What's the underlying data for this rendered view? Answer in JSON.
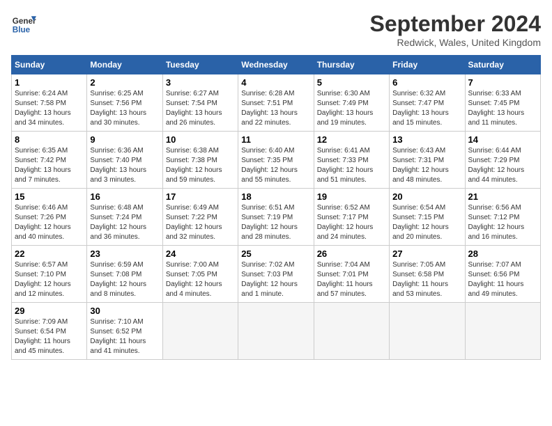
{
  "header": {
    "logo_line1": "General",
    "logo_line2": "Blue",
    "month": "September 2024",
    "location": "Redwick, Wales, United Kingdom"
  },
  "weekdays": [
    "Sunday",
    "Monday",
    "Tuesday",
    "Wednesday",
    "Thursday",
    "Friday",
    "Saturday"
  ],
  "weeks": [
    [
      {
        "day": "1",
        "info": "Sunrise: 6:24 AM\nSunset: 7:58 PM\nDaylight: 13 hours\nand 34 minutes."
      },
      {
        "day": "2",
        "info": "Sunrise: 6:25 AM\nSunset: 7:56 PM\nDaylight: 13 hours\nand 30 minutes."
      },
      {
        "day": "3",
        "info": "Sunrise: 6:27 AM\nSunset: 7:54 PM\nDaylight: 13 hours\nand 26 minutes."
      },
      {
        "day": "4",
        "info": "Sunrise: 6:28 AM\nSunset: 7:51 PM\nDaylight: 13 hours\nand 22 minutes."
      },
      {
        "day": "5",
        "info": "Sunrise: 6:30 AM\nSunset: 7:49 PM\nDaylight: 13 hours\nand 19 minutes."
      },
      {
        "day": "6",
        "info": "Sunrise: 6:32 AM\nSunset: 7:47 PM\nDaylight: 13 hours\nand 15 minutes."
      },
      {
        "day": "7",
        "info": "Sunrise: 6:33 AM\nSunset: 7:45 PM\nDaylight: 13 hours\nand 11 minutes."
      }
    ],
    [
      {
        "day": "8",
        "info": "Sunrise: 6:35 AM\nSunset: 7:42 PM\nDaylight: 13 hours\nand 7 minutes."
      },
      {
        "day": "9",
        "info": "Sunrise: 6:36 AM\nSunset: 7:40 PM\nDaylight: 13 hours\nand 3 minutes."
      },
      {
        "day": "10",
        "info": "Sunrise: 6:38 AM\nSunset: 7:38 PM\nDaylight: 12 hours\nand 59 minutes."
      },
      {
        "day": "11",
        "info": "Sunrise: 6:40 AM\nSunset: 7:35 PM\nDaylight: 12 hours\nand 55 minutes."
      },
      {
        "day": "12",
        "info": "Sunrise: 6:41 AM\nSunset: 7:33 PM\nDaylight: 12 hours\nand 51 minutes."
      },
      {
        "day": "13",
        "info": "Sunrise: 6:43 AM\nSunset: 7:31 PM\nDaylight: 12 hours\nand 48 minutes."
      },
      {
        "day": "14",
        "info": "Sunrise: 6:44 AM\nSunset: 7:29 PM\nDaylight: 12 hours\nand 44 minutes."
      }
    ],
    [
      {
        "day": "15",
        "info": "Sunrise: 6:46 AM\nSunset: 7:26 PM\nDaylight: 12 hours\nand 40 minutes."
      },
      {
        "day": "16",
        "info": "Sunrise: 6:48 AM\nSunset: 7:24 PM\nDaylight: 12 hours\nand 36 minutes."
      },
      {
        "day": "17",
        "info": "Sunrise: 6:49 AM\nSunset: 7:22 PM\nDaylight: 12 hours\nand 32 minutes."
      },
      {
        "day": "18",
        "info": "Sunrise: 6:51 AM\nSunset: 7:19 PM\nDaylight: 12 hours\nand 28 minutes."
      },
      {
        "day": "19",
        "info": "Sunrise: 6:52 AM\nSunset: 7:17 PM\nDaylight: 12 hours\nand 24 minutes."
      },
      {
        "day": "20",
        "info": "Sunrise: 6:54 AM\nSunset: 7:15 PM\nDaylight: 12 hours\nand 20 minutes."
      },
      {
        "day": "21",
        "info": "Sunrise: 6:56 AM\nSunset: 7:12 PM\nDaylight: 12 hours\nand 16 minutes."
      }
    ],
    [
      {
        "day": "22",
        "info": "Sunrise: 6:57 AM\nSunset: 7:10 PM\nDaylight: 12 hours\nand 12 minutes."
      },
      {
        "day": "23",
        "info": "Sunrise: 6:59 AM\nSunset: 7:08 PM\nDaylight: 12 hours\nand 8 minutes."
      },
      {
        "day": "24",
        "info": "Sunrise: 7:00 AM\nSunset: 7:05 PM\nDaylight: 12 hours\nand 4 minutes."
      },
      {
        "day": "25",
        "info": "Sunrise: 7:02 AM\nSunset: 7:03 PM\nDaylight: 12 hours\nand 1 minute."
      },
      {
        "day": "26",
        "info": "Sunrise: 7:04 AM\nSunset: 7:01 PM\nDaylight: 11 hours\nand 57 minutes."
      },
      {
        "day": "27",
        "info": "Sunrise: 7:05 AM\nSunset: 6:58 PM\nDaylight: 11 hours\nand 53 minutes."
      },
      {
        "day": "28",
        "info": "Sunrise: 7:07 AM\nSunset: 6:56 PM\nDaylight: 11 hours\nand 49 minutes."
      }
    ],
    [
      {
        "day": "29",
        "info": "Sunrise: 7:09 AM\nSunset: 6:54 PM\nDaylight: 11 hours\nand 45 minutes."
      },
      {
        "day": "30",
        "info": "Sunrise: 7:10 AM\nSunset: 6:52 PM\nDaylight: 11 hours\nand 41 minutes."
      },
      {
        "day": "",
        "info": ""
      },
      {
        "day": "",
        "info": ""
      },
      {
        "day": "",
        "info": ""
      },
      {
        "day": "",
        "info": ""
      },
      {
        "day": "",
        "info": ""
      }
    ]
  ]
}
